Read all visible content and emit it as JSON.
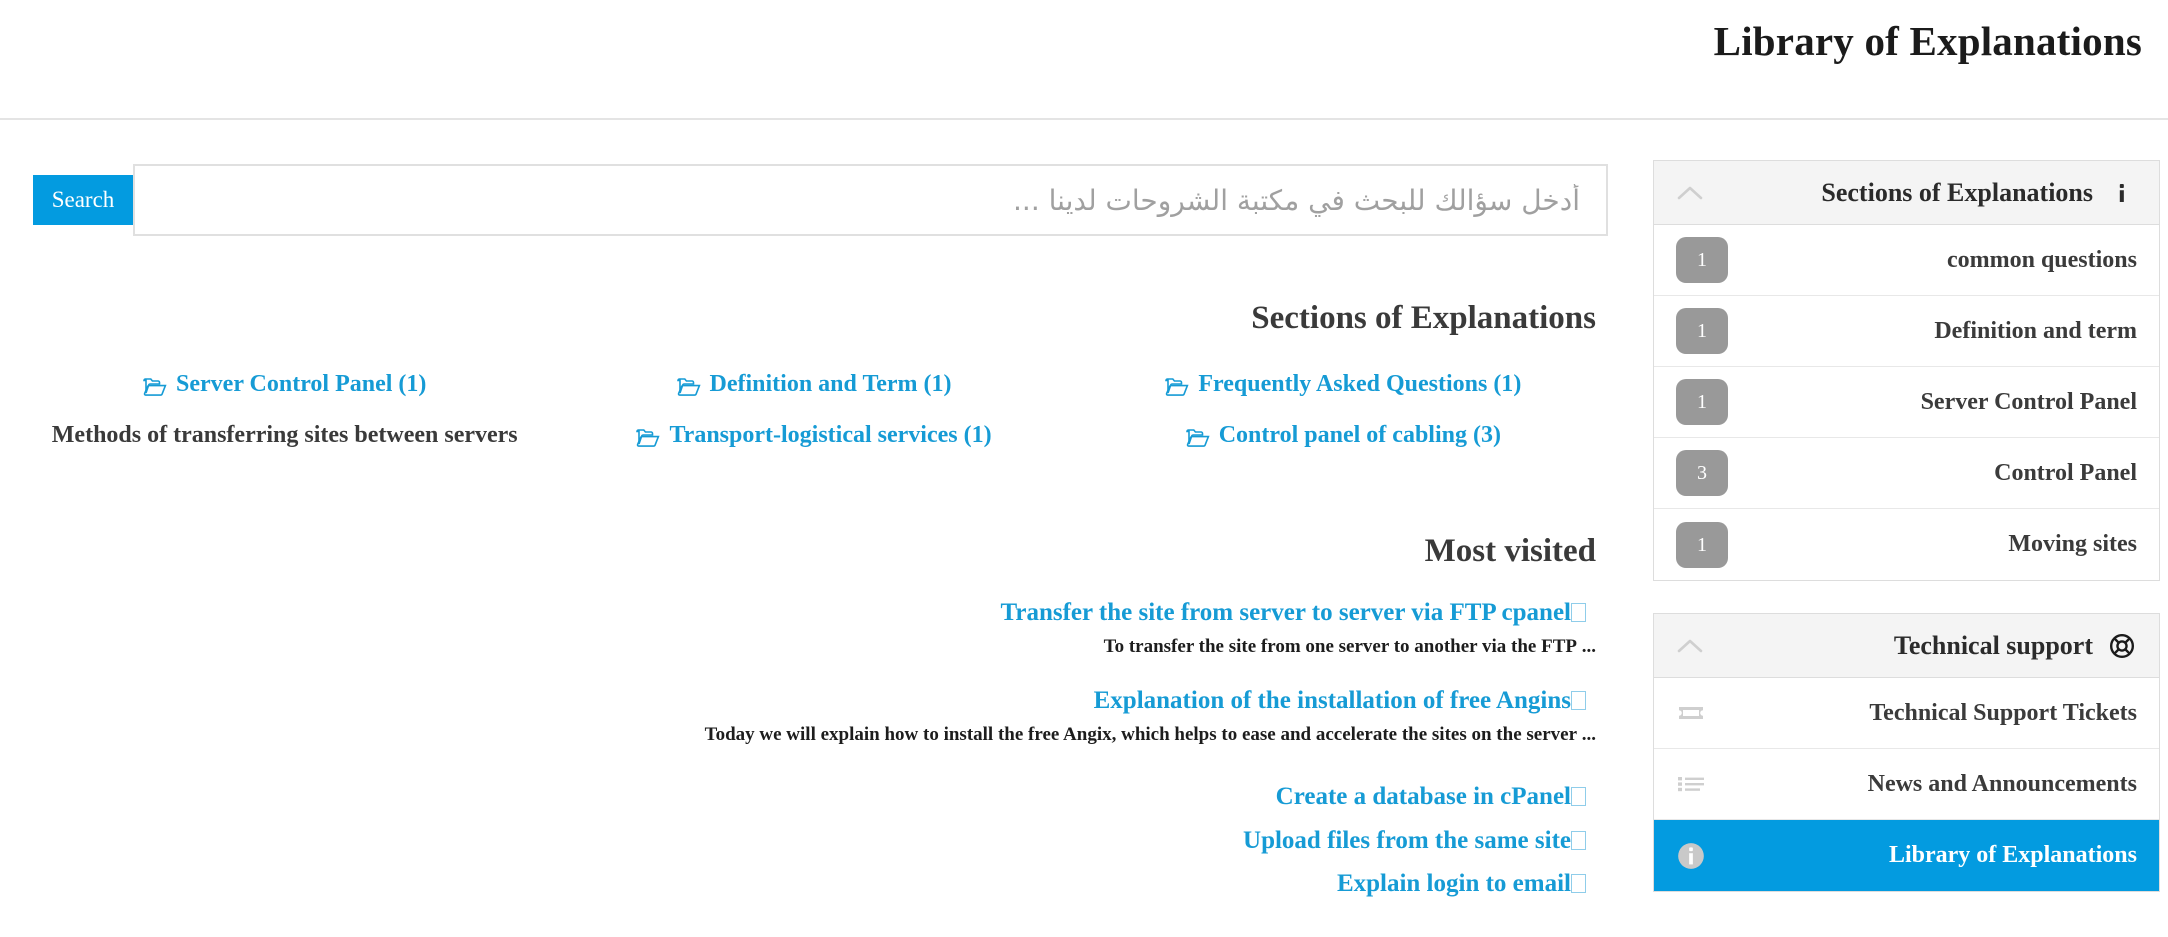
{
  "header": {
    "title": "Library of Explanations"
  },
  "search": {
    "button_label": "Search",
    "placeholder": "أدخل سؤالك للبحث في مكتبة الشروحات لدينا ...",
    "value": ""
  },
  "main": {
    "sections_heading": "Sections of Explanations",
    "sections": [
      {
        "label": "(Frequently Asked Questions (1",
        "icon": "folder-open-icon",
        "link": true
      },
      {
        "label": "(Definition and Term (1",
        "icon": "folder-open-icon",
        "link": true
      },
      {
        "label": "(Server Control Panel (1",
        "icon": "folder-open-icon",
        "link": true
      },
      {
        "label": "(Control panel of cabling (3",
        "icon": "folder-open-icon",
        "link": true
      },
      {
        "label": "(Transport-logistical services (1",
        "icon": "folder-open-icon",
        "link": true
      },
      {
        "label": "Methods of transferring sites between servers",
        "icon": "",
        "link": false
      }
    ],
    "most_visited_heading": "Most visited",
    "most_visited": [
      {
        "title": "Transfer the site from server to server via FTP cpanel",
        "icon": "missing-glyph-icon",
        "desc": "... To transfer the site from one server to another via the FTP"
      },
      {
        "title": "Explanation of the installation of free Angins",
        "icon": "missing-glyph-icon",
        "desc": "... Today we will explain how to install the free Angix, which helps to ease and accelerate the sites on the server"
      },
      {
        "title": "Create a database in cPanel",
        "icon": "missing-glyph-icon",
        "desc": ""
      },
      {
        "title": "Upload files from the same site",
        "icon": "missing-glyph-icon",
        "desc": ""
      },
      {
        "title": "Explain login to email",
        "icon": "missing-glyph-icon",
        "desc": ""
      }
    ]
  },
  "sidebar": {
    "sections_panel": {
      "title": "Sections of Explanations",
      "icon": "info-icon",
      "collapse_icon": "chevron-up-icon",
      "items": [
        {
          "label": "common questions",
          "count": "1"
        },
        {
          "label": "Definition and term",
          "count": "1"
        },
        {
          "label": "Server Control Panel",
          "count": "1"
        },
        {
          "label": "Control Panel",
          "count": "3"
        },
        {
          "label": "Moving sites",
          "count": "1"
        }
      ]
    },
    "support_panel": {
      "title": "Technical support",
      "icon": "life-ring-icon",
      "collapse_icon": "chevron-up-icon",
      "items": [
        {
          "label": "Technical Support Tickets",
          "icon": "ticket-icon",
          "active": false
        },
        {
          "label": "News and Announcements",
          "icon": "list-icon",
          "active": false
        },
        {
          "label": "Library of Explanations",
          "icon": "info-circle-icon",
          "active": true
        }
      ]
    }
  },
  "colors": {
    "accent": "#039BE0",
    "link": "#169BD5",
    "badge": "#999999",
    "panel_header_bg": "#f4f4f4",
    "text_dark": "#3a3a3a"
  }
}
